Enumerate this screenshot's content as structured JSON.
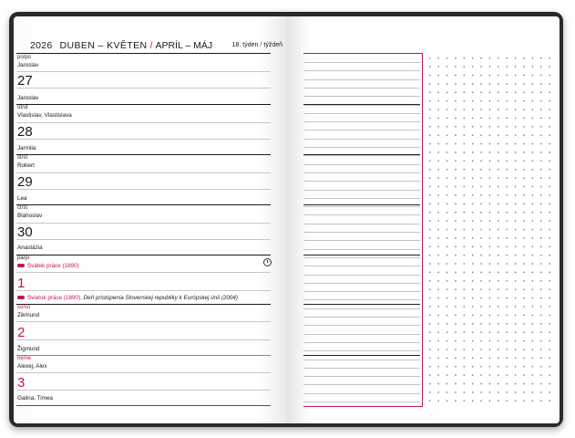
{
  "header": {
    "year": "2026",
    "month_cz": "DUBEN – KVĚTEN",
    "slash": "/",
    "month_sk": "APRÍL – MÁJ",
    "week_cz": "18. týden",
    "week_sk": "týždeň"
  },
  "days": [
    {
      "abbr": "po/po",
      "name_cz": "Jaroslav",
      "num": "27",
      "name_sk": "Jaroslav"
    },
    {
      "abbr": "út/ut",
      "name_cz": "Vlastislav, Vlastislava",
      "num": "28",
      "name_sk": "Jarmila"
    },
    {
      "abbr": "st/st",
      "name_cz": "Robert",
      "num": "29",
      "name_sk": "Lea"
    },
    {
      "abbr": "čt/št",
      "name_cz": "Blahoslav",
      "num": "30",
      "name_sk": "Anastázia"
    },
    {
      "abbr": "pá/pi",
      "holiday_cz": "Svátek práce (1890)",
      "num": "1",
      "holiday_sk": "Sviatok práce (1890),",
      "note_sk": "Deň pristúpenia Slovenskej republiky k Európskej únii (2004)"
    },
    {
      "abbr": "so/so",
      "name_cz": "Zikmund",
      "num": "2",
      "name_sk": "Žigmund"
    },
    {
      "abbr": "ne/ne",
      "name_cz": "Alexej, Alex",
      "num": "3",
      "name_sk": "Galina, Timea"
    }
  ],
  "colors": {
    "accent": "#c2184b",
    "cover": "#2a2a2a",
    "text": "#1a1a1a"
  },
  "icons": {
    "clock": "clock-icon",
    "flag": "holiday-flag-icon"
  }
}
